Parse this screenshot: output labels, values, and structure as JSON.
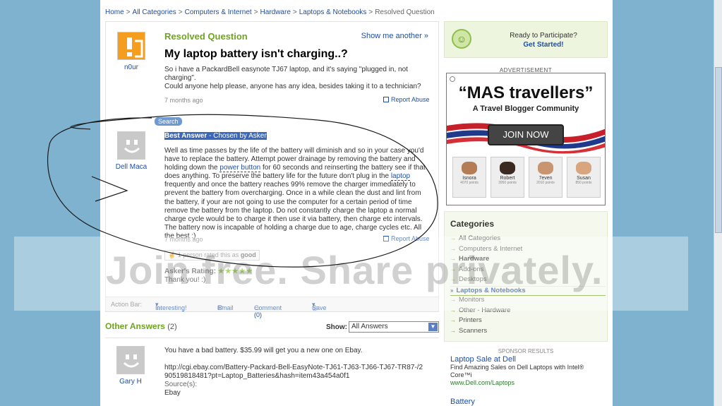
{
  "breadcrumb": {
    "items": [
      "Home",
      "All Categories",
      "Computers & Internet",
      "Hardware",
      "Laptops & Notebooks"
    ],
    "current": "Resolved Question",
    "separator": ">"
  },
  "question": {
    "status_label": "Resolved Question",
    "show_another": "Show me another »",
    "asker_name": "n0ur",
    "title": "My laptop battery isn't charging..?",
    "body": "So i have a PackardBell easynote TJ67 laptop, and it's saying \"plugged in, not charging\".\nCould anyone help please, anyone has any idea, besides taking it to a technician?",
    "time": "7 months ago",
    "report_abuse": "Report Abuse"
  },
  "search_tag": "Search",
  "best_answer": {
    "label": "Best Answer",
    "chosen_by": " - Chosen by Asker",
    "answerer_name": "Dell Maca",
    "body_parts": {
      "p1": "Well as time passes by the life of the battery will diminish and so in your case you'd have to replace the battery. Attempt power drainage by removing the battery and holding down the ",
      "link1": "power button",
      "p2": " for 60 seconds and reinserting the battery see if that does anything. To preserve the battery life for the future don't plug in the ",
      "link2": "laptop",
      "p3": " frequently and once the battery reaches 99% remove the charger immediately to prevent the battery from overcharging. Once in a while clean the dust and lint from the battery, if your are not going to use the computer for a certain period of time remove the battery from the laptop. Do not constantly charge the laptop a normal charge cycle would be to charge it then use it via battery, then charge etc intervals. The battery now is incapable of holding a charge due to age, charge cycles etc. All the best :)"
    },
    "time": "7 months ago",
    "report_abuse": "Report Abuse",
    "rated": "1 person rated this as",
    "rated_word": "good",
    "asker_rating_label": "Asker's Rating:",
    "stars": "★★★★★",
    "asker_comment": "Thank you! :)"
  },
  "action_bar": {
    "label": "Action Bar:",
    "interesting": "Interesting!",
    "email": "Email",
    "comment": "Comment (0)",
    "save": "Save"
  },
  "other_answers": {
    "label": "Other Answers",
    "count": "(2)",
    "show_label": "Show:",
    "show_value": "All Answers",
    "answer": {
      "answerer_name": "Gary H",
      "line1": "You have a bad battery. $35.99 will get you a new one on Ebay.",
      "line2": "http://cgi.ebay.com/Battery-Packard-Bell-EasyNote-TJ61-TJ63-TJ66-TJ67-TR87-/290519818481?pt=Laptop_Batteries&hash=item43a454a0f1",
      "source_label": "Source(s):",
      "source": "Ebay"
    }
  },
  "participate": {
    "line1": "Ready to Participate?",
    "line2": "Get Started!"
  },
  "advert": {
    "label": "ADVERTISEMENT",
    "headline": "“MAS travellers”",
    "sub": "A Travel Blogger Community",
    "join": "JOIN NOW",
    "people": [
      {
        "name": "Isnora",
        "pts": "4070 points"
      },
      {
        "name": "Robert",
        "pts": "3950 points"
      },
      {
        "name": "7even",
        "pts": "2010 points"
      },
      {
        "name": "Susan",
        "pts": "850 points"
      }
    ]
  },
  "categories": {
    "title": "Categories",
    "items": [
      {
        "label": "All Categories",
        "kind": "normal"
      },
      {
        "label": "Computers & Internet",
        "kind": "normal"
      },
      {
        "label": "Hardware",
        "kind": "current"
      },
      {
        "label": "Add-ons",
        "kind": "normal"
      },
      {
        "label": "Desktops",
        "kind": "normal"
      },
      {
        "label": "Laptops & Notebooks",
        "kind": "selected"
      },
      {
        "label": "Monitors",
        "kind": "normal"
      },
      {
        "label": "Other - Hardware",
        "kind": "normal"
      },
      {
        "label": "Printers",
        "kind": "normal"
      },
      {
        "label": "Scanners",
        "kind": "normal"
      }
    ]
  },
  "sponsor": {
    "label": "SPONSOR RESULTS",
    "title": "Laptop Sale at Dell",
    "desc": "Find Amazing Sales on Dell Laptops with Intel® Core™i",
    "url": "www.Dell.com/Laptops",
    "next_title": "Battery"
  },
  "watermark": "Join free. Share privately.",
  "colors": {
    "page_bg": "#7fb2cf",
    "accent_green": "#6fa323",
    "link_blue": "#1d4fa4"
  }
}
